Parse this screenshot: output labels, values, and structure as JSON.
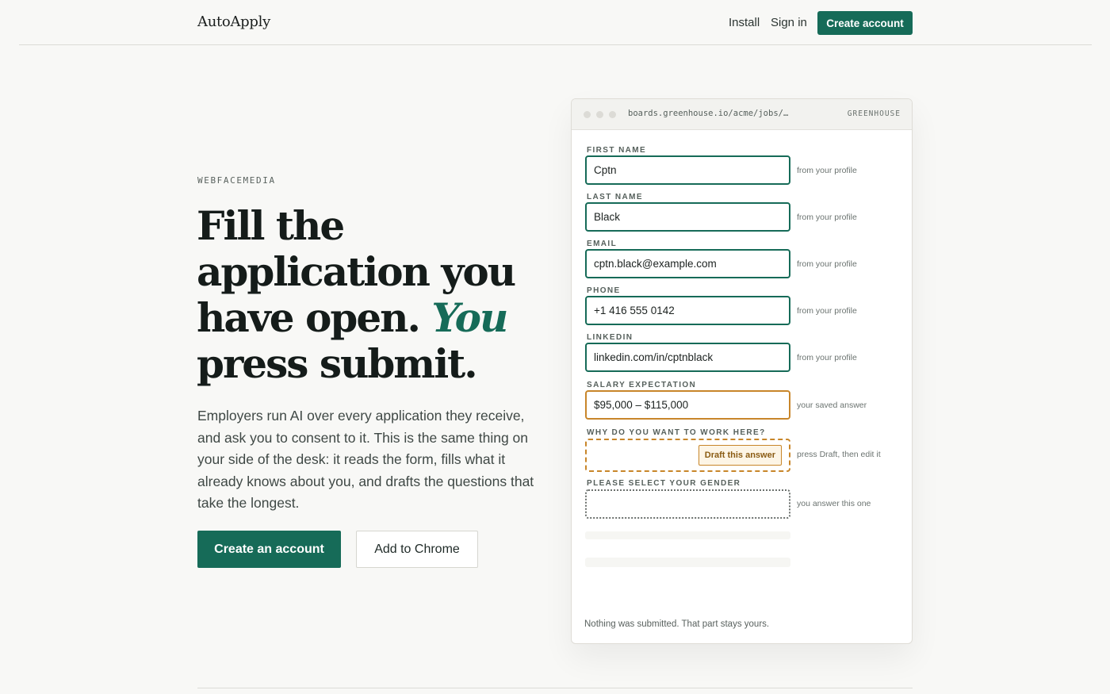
{
  "header": {
    "logo": "AutoApply",
    "nav": {
      "install": "Install",
      "sign_in": "Sign in",
      "create_account": "Create account"
    }
  },
  "hero": {
    "eyebrow": "WEBFACEMEDIA",
    "headline_part1": "Fill the application you have open.",
    "headline_accent": "You",
    "headline_part2": "press submit.",
    "lede": "Employers run AI over every application they receive, and ask you to consent to it. This is the same thing on your side of the desk: it reads the form, fills what it already knows about you, and drafts the questions that take the longest.",
    "primary_cta": "Create an account",
    "secondary_cta": "Add to Chrome"
  },
  "mock": {
    "url": "boards.greenhouse.io/acme/jobs/…",
    "site": "GREENHOUSE",
    "fields": [
      {
        "label": "FIRST NAME",
        "value": "Cptn",
        "hint": "from your profile"
      },
      {
        "label": "LAST NAME",
        "value": "Black",
        "hint": "from your profile"
      },
      {
        "label": "EMAIL",
        "value": "cptn.black@example.com",
        "hint": "from your profile"
      },
      {
        "label": "PHONE",
        "value": "+1 416 555 0142",
        "hint": "from your profile"
      },
      {
        "label": "LINKEDIN",
        "value": "linkedin.com/in/cptnblack",
        "hint": "from your profile"
      },
      {
        "label": "SALARY EXPECTATION",
        "value": "$95,000 – $115,000",
        "hint": "your saved answer"
      }
    ],
    "why_label": "WHY DO YOU WANT TO WORK HERE?",
    "draft_button": "Draft this answer",
    "why_hint": "press Draft, then edit it",
    "gender_label": "PLEASE SELECT YOUR GENDER",
    "gender_hint": "you answer this one",
    "footer": "Nothing was submitted. That part stays yours."
  },
  "colors": {
    "accent": "#166b58",
    "saved_answer": "#c8862a",
    "background": "#f8f8f6"
  }
}
